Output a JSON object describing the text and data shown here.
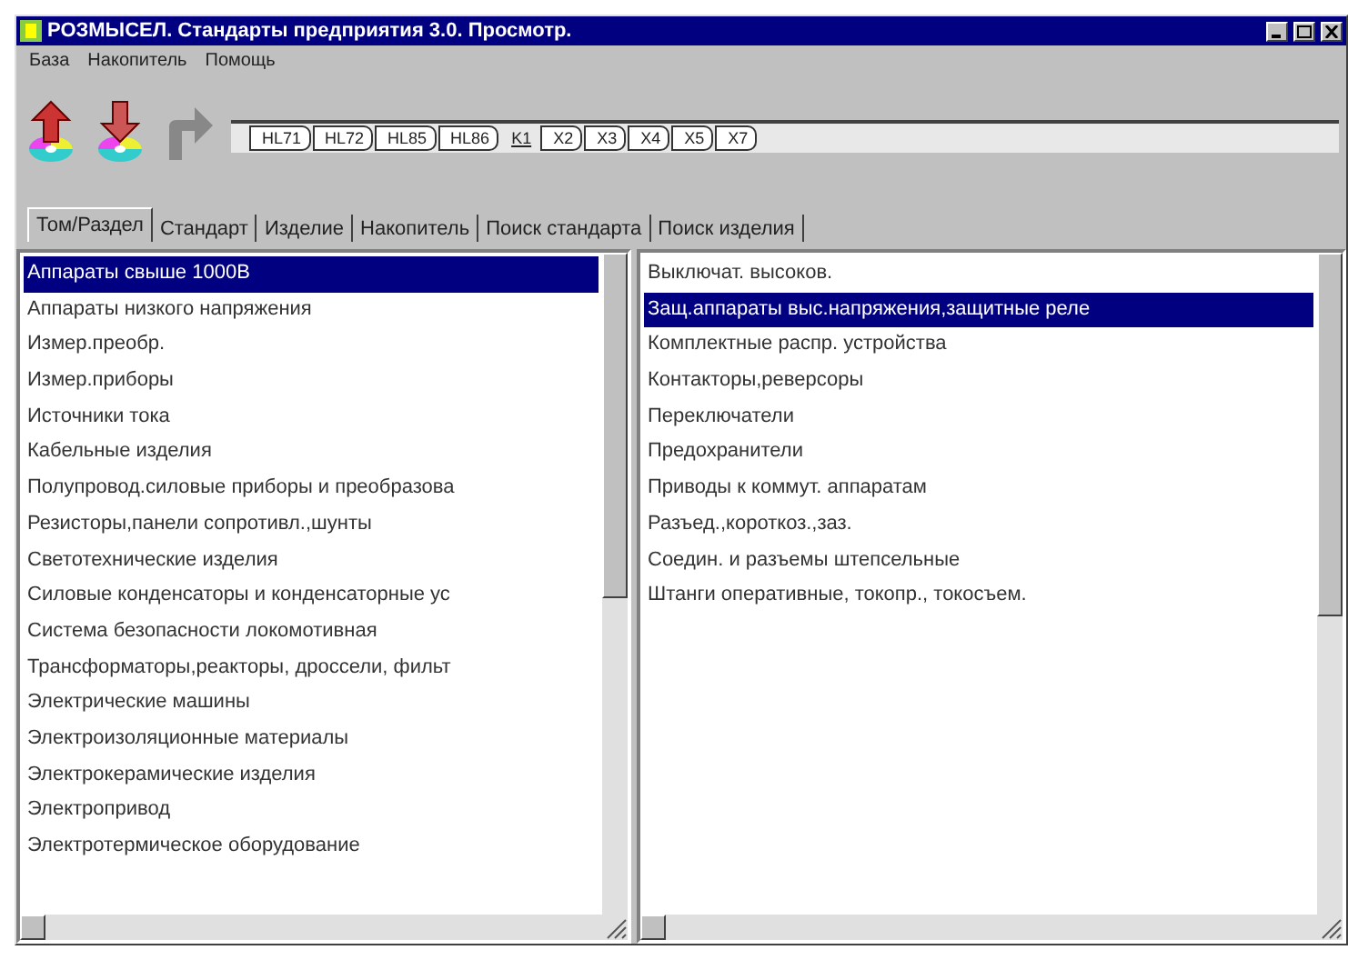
{
  "window": {
    "title": "РОЗМЫСЕЛ. Стандарты предприятия 3.0. Просмотр."
  },
  "menu": [
    "База",
    "Накопитель",
    "Помощь"
  ],
  "toolbar": {
    "buttons": [
      {
        "kind": "up"
      },
      {
        "kind": "down"
      },
      {
        "kind": "forward"
      }
    ]
  },
  "path": [
    {
      "label": "HL71",
      "selected": false
    },
    {
      "label": "HL72",
      "selected": false
    },
    {
      "label": "HL85",
      "selected": false
    },
    {
      "label": "HL86",
      "selected": false
    },
    {
      "label": "K1",
      "selected": true
    },
    {
      "label": "X2",
      "selected": false
    },
    {
      "label": "X3",
      "selected": false
    },
    {
      "label": "X4",
      "selected": false
    },
    {
      "label": "X5",
      "selected": false
    },
    {
      "label": "X7",
      "selected": false
    }
  ],
  "tabs": [
    {
      "label": "Том/Раздел",
      "selected": true
    },
    {
      "label": "Стандарт",
      "selected": false
    },
    {
      "label": "Изделие",
      "selected": false
    },
    {
      "label": "Накопитель",
      "selected": false
    },
    {
      "label": "Поиск стандарта",
      "selected": false
    },
    {
      "label": "Поиск изделия",
      "selected": false
    }
  ],
  "sections": [
    {
      "label": "Аппараты свыше 1000В",
      "selected": true
    },
    {
      "label": "Аппараты низкого напряжения",
      "selected": false
    },
    {
      "label": "Измер.преобр.",
      "selected": false
    },
    {
      "label": "Измер.приборы",
      "selected": false
    },
    {
      "label": "Источники тока",
      "selected": false
    },
    {
      "label": "Кабельные изделия",
      "selected": false
    },
    {
      "label": "Полупровод.силовые приборы и преобразова",
      "selected": false
    },
    {
      "label": "Резисторы,панели сопротивл.,шунты",
      "selected": false
    },
    {
      "label": "Светотехнические изделия",
      "selected": false
    },
    {
      "label": "Силовые конденсаторы и конденсаторные ус",
      "selected": false
    },
    {
      "label": "Система безопасности локомотивная",
      "selected": false
    },
    {
      "label": "Трансформаторы,реакторы, дроссели, фильт",
      "selected": false
    },
    {
      "label": "Электрические машины",
      "selected": false
    },
    {
      "label": "Электроизоляционные материалы",
      "selected": false
    },
    {
      "label": "Электрокерамические изделия",
      "selected": false
    },
    {
      "label": "Электропривод",
      "selected": false
    },
    {
      "label": "Электротермическое оборудование",
      "selected": false
    }
  ],
  "subsections": [
    {
      "label": "Выключат. высоков.",
      "selected": false
    },
    {
      "label": "Защ.аппараты выс.напряжения,защитные реле",
      "selected": true
    },
    {
      "label": "Комплектные распр. устройства",
      "selected": false
    },
    {
      "label": "Контакторы,реверсоры",
      "selected": false
    },
    {
      "label": "Переключатели",
      "selected": false
    },
    {
      "label": "Предохранители",
      "selected": false
    },
    {
      "label": "Приводы к коммут. аппаратам",
      "selected": false
    },
    {
      "label": "Разъед.,короткоз.,заз.",
      "selected": false
    },
    {
      "label": "Соедин. и разъемы штепсельные",
      "selected": false
    },
    {
      "label": "Штанги оперативные, токопр., токосъем.",
      "selected": false
    }
  ]
}
